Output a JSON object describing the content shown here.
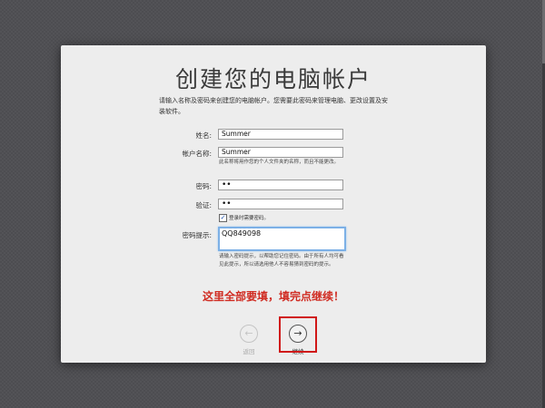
{
  "title": "创建您的电脑帐户",
  "intro": "请输入名称及密码来创建您的电脑帐户。您需要此密码来管理电脑、更改设置及安装软件。",
  "fields": {
    "full_name": {
      "label": "姓名:",
      "value": "Summer"
    },
    "account_name": {
      "label": "帐户名称:",
      "value": "Summer",
      "note": "此名称将用作您的个人文件夹的名称，而且不能更改。"
    },
    "password": {
      "label": "密码:",
      "value": "••"
    },
    "verify": {
      "label": "验证:",
      "value": "••"
    },
    "hint": {
      "label": "密码提示:",
      "value": "QQ849098",
      "note": "请输入密码提示，以帮助您记住密码。由于所有人均可看见此提示，所以请选用他人不容易猜到密码的提示。"
    }
  },
  "require_password": {
    "label": "登录时需要密码。",
    "checked": true
  },
  "annotation": "这里全部要填，填完点继续！",
  "buttons": {
    "back": {
      "label": "返回",
      "icon": "back-arrow-icon",
      "glyph": "←"
    },
    "continue": {
      "label": "继续",
      "icon": "forward-arrow-icon",
      "glyph": "→"
    }
  },
  "colors": {
    "notice": "#d02c22",
    "highlight": "#d01818",
    "focus": "#7cb0e6"
  }
}
